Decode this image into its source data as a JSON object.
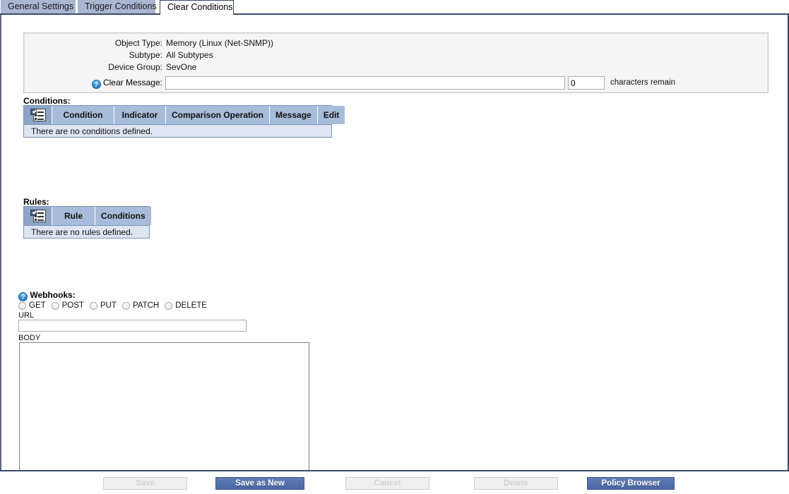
{
  "tabs": [
    {
      "label": "General Settings",
      "active": false
    },
    {
      "label": "Trigger Conditions",
      "active": false
    },
    {
      "label": "Clear Conditions",
      "active": true
    }
  ],
  "info": {
    "object_type_label": "Object Type:",
    "object_type_value": "Memory (Linux (Net-SNMP))",
    "subtype_label": "Subtype:",
    "subtype_value": "All Subtypes",
    "device_group_label": "Device Group:",
    "device_group_value": "SevOne",
    "clear_message_label": "Clear Message:",
    "clear_message_value": "",
    "clear_message_placeholder": "",
    "help_glyph": "?",
    "characters_remain_value": "0",
    "characters_remain_label": "characters remain"
  },
  "conditions": {
    "title": "Conditions:",
    "icon_name": "add-list-icon",
    "columns": [
      "Condition",
      "Indicator",
      "Comparison Operation",
      "Message",
      "Edit"
    ],
    "empty_text": "There are no conditions defined.",
    "rows": []
  },
  "rules": {
    "title": "Rules:",
    "icon_name": "add-list-icon",
    "columns": [
      "Rule",
      "Conditions"
    ],
    "empty_text": "There are no rules defined.",
    "rows": []
  },
  "webhooks": {
    "title": "Webhooks:",
    "help_glyph": "?",
    "methods": [
      {
        "label": "GET",
        "selected": false
      },
      {
        "label": "POST",
        "selected": false
      },
      {
        "label": "PUT",
        "selected": false
      },
      {
        "label": "PATCH",
        "selected": false
      },
      {
        "label": "DELETE",
        "selected": false
      }
    ],
    "url_label": "URL",
    "url_value": "",
    "body_label": "BODY",
    "body_value": ""
  },
  "buttons": [
    {
      "label": "Save",
      "enabled": false
    },
    {
      "label": "Save as New",
      "enabled": true
    },
    {
      "label": "Cancel",
      "enabled": false
    },
    {
      "label": "Delete",
      "enabled": false
    },
    {
      "label": "Policy Browser",
      "enabled": true
    }
  ],
  "colors": {
    "tab_inactive": "#aab6d2",
    "tab_active": "#ffffff",
    "frame_border": "#3c4a6b",
    "grid_header": "#a7bcd9",
    "grid_empty_row": "#dce5f1",
    "primary_button": "#4a68a4",
    "help_icon": "#2f8ed6"
  }
}
